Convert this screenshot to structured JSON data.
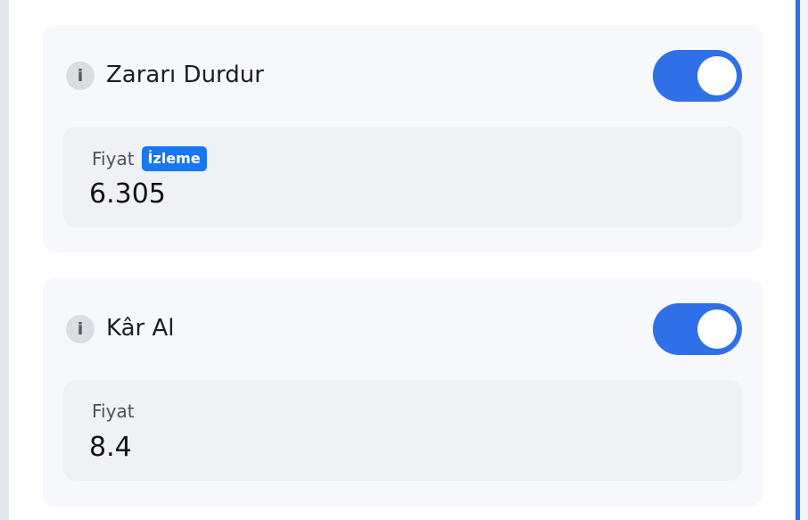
{
  "stop_loss": {
    "title": "Zararı Durdur",
    "info_icon": "i",
    "enabled": true,
    "price_label": "Fiyat",
    "badge": "İzleme",
    "price_value": "6.305"
  },
  "take_profit": {
    "title": "Kâr Al",
    "info_icon": "i",
    "enabled": true,
    "price_label": "Fiyat",
    "price_value": "8.4"
  },
  "colors": {
    "accent": "#2f6fe8",
    "badge": "#1877f2",
    "card_bg": "#f7f8fc",
    "field_bg": "#f0f1f5"
  }
}
